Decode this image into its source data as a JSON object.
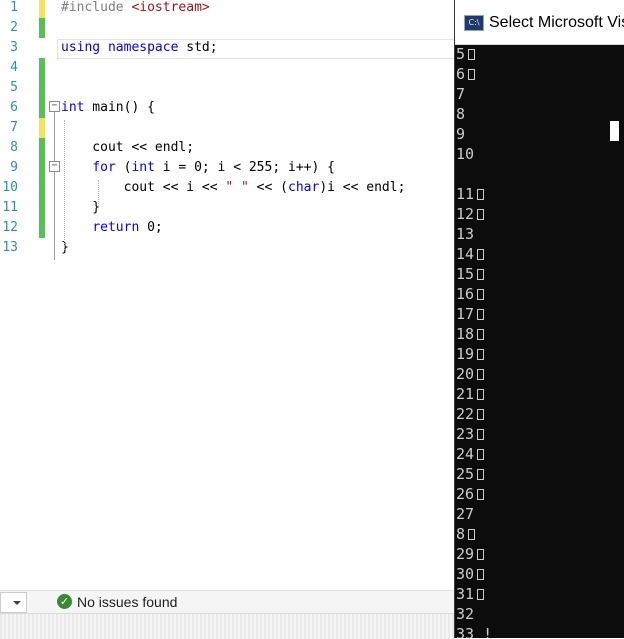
{
  "editor": {
    "lines": [
      {
        "num": "1",
        "change": "unsaved",
        "tokens": [
          {
            "t": "#include ",
            "c": "pp"
          },
          {
            "t": "<iostream>",
            "c": "str"
          }
        ]
      },
      {
        "num": "2",
        "change": "saved",
        "tokens": []
      },
      {
        "num": "3",
        "change": "none",
        "tokens": [
          {
            "t": "using",
            "c": "kw"
          },
          {
            "t": " "
          },
          {
            "t": "namespace",
            "c": "kw"
          },
          {
            "t": " std;"
          }
        ]
      },
      {
        "num": "4",
        "change": "saved",
        "tokens": []
      },
      {
        "num": "5",
        "change": "saved",
        "tokens": []
      },
      {
        "num": "6",
        "change": "saved",
        "tokens": [
          {
            "t": "int",
            "c": "kw"
          },
          {
            "t": " main() {"
          }
        ]
      },
      {
        "num": "7",
        "change": "unsaved",
        "tokens": []
      },
      {
        "num": "8",
        "change": "saved",
        "tokens": [
          {
            "t": "    cout << endl;"
          }
        ]
      },
      {
        "num": "9",
        "change": "saved",
        "tokens": [
          {
            "t": "    "
          },
          {
            "t": "for",
            "c": "kw"
          },
          {
            "t": " ("
          },
          {
            "t": "int",
            "c": "kw"
          },
          {
            "t": " i = 0; i < 255; i++) {"
          }
        ]
      },
      {
        "num": "10",
        "change": "saved",
        "tokens": [
          {
            "t": "        cout << i << "
          },
          {
            "t": "\" \"",
            "c": "str"
          },
          {
            "t": " << ("
          },
          {
            "t": "char",
            "c": "kw"
          },
          {
            "t": ")i << endl;"
          }
        ]
      },
      {
        "num": "11",
        "change": "saved",
        "tokens": [
          {
            "t": "    }"
          }
        ]
      },
      {
        "num": "12",
        "change": "saved",
        "tokens": [
          {
            "t": "    "
          },
          {
            "t": "return",
            "c": "kw"
          },
          {
            "t": " 0;"
          }
        ]
      },
      {
        "num": "13",
        "change": "none",
        "tokens": [
          {
            "t": "}"
          }
        ]
      }
    ]
  },
  "statusbar": {
    "issues_icon": "check-circle-icon",
    "issues_text": "No issues found"
  },
  "console": {
    "title": "Select Microsoft Visu",
    "icon_text": "C:\\",
    "lines": [
      {
        "text": "5",
        "box": true
      },
      {
        "text": "6",
        "box": true
      },
      {
        "text": "7",
        "box": false
      },
      {
        "text": "8",
        "box": false
      },
      {
        "text": "9",
        "box": false
      },
      {
        "text": "10",
        "box": false
      },
      {
        "text": "",
        "box": false
      },
      {
        "text": "11",
        "box": true
      },
      {
        "text": "12",
        "box": true
      },
      {
        "text": "13",
        "box": false
      },
      {
        "text": "14",
        "box": true
      },
      {
        "text": "15",
        "box": true
      },
      {
        "text": "16",
        "box": true
      },
      {
        "text": "17",
        "box": true
      },
      {
        "text": "18",
        "box": true
      },
      {
        "text": "19",
        "box": true
      },
      {
        "text": "20",
        "box": true
      },
      {
        "text": "21",
        "box": true
      },
      {
        "text": "22",
        "box": true
      },
      {
        "text": "23",
        "box": true
      },
      {
        "text": "24",
        "box": true
      },
      {
        "text": "25",
        "box": true
      },
      {
        "text": "26",
        "box": true
      },
      {
        "text": "27",
        "box": false
      },
      {
        "text": "8",
        "box": true
      },
      {
        "text": "29",
        "box": true
      },
      {
        "text": "30",
        "box": true
      },
      {
        "text": "31",
        "box": true
      },
      {
        "text": "32",
        "box": false
      },
      {
        "text": "33 !",
        "box": false
      }
    ]
  },
  "colors": {
    "line_number": "#2b91af",
    "keyword": "#0000ff",
    "string": "#a31515",
    "change_saved": "#57c056",
    "change_unsaved": "#f5e35a",
    "console_bg": "#0c0c0c",
    "console_fg": "#cccccc"
  }
}
